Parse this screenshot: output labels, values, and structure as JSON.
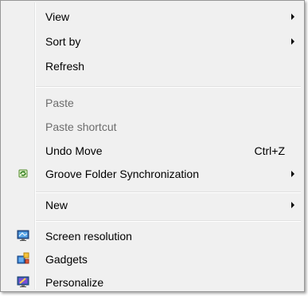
{
  "menu": {
    "items": [
      {
        "label": "View"
      },
      {
        "label": "Sort by"
      },
      {
        "label": "Refresh"
      },
      {
        "label": "Paste"
      },
      {
        "label": "Paste shortcut"
      },
      {
        "label": "Undo Move",
        "shortcut": "Ctrl+Z"
      },
      {
        "label": "Groove Folder Synchronization"
      },
      {
        "label": "New"
      },
      {
        "label": "Screen resolution"
      },
      {
        "label": "Gadgets"
      },
      {
        "label": "Personalize"
      }
    ]
  },
  "icons": {
    "groove": "groove-sync-icon",
    "screen": "screen-resolution-icon",
    "gadgets": "gadgets-icon",
    "personalize": "personalize-icon"
  }
}
